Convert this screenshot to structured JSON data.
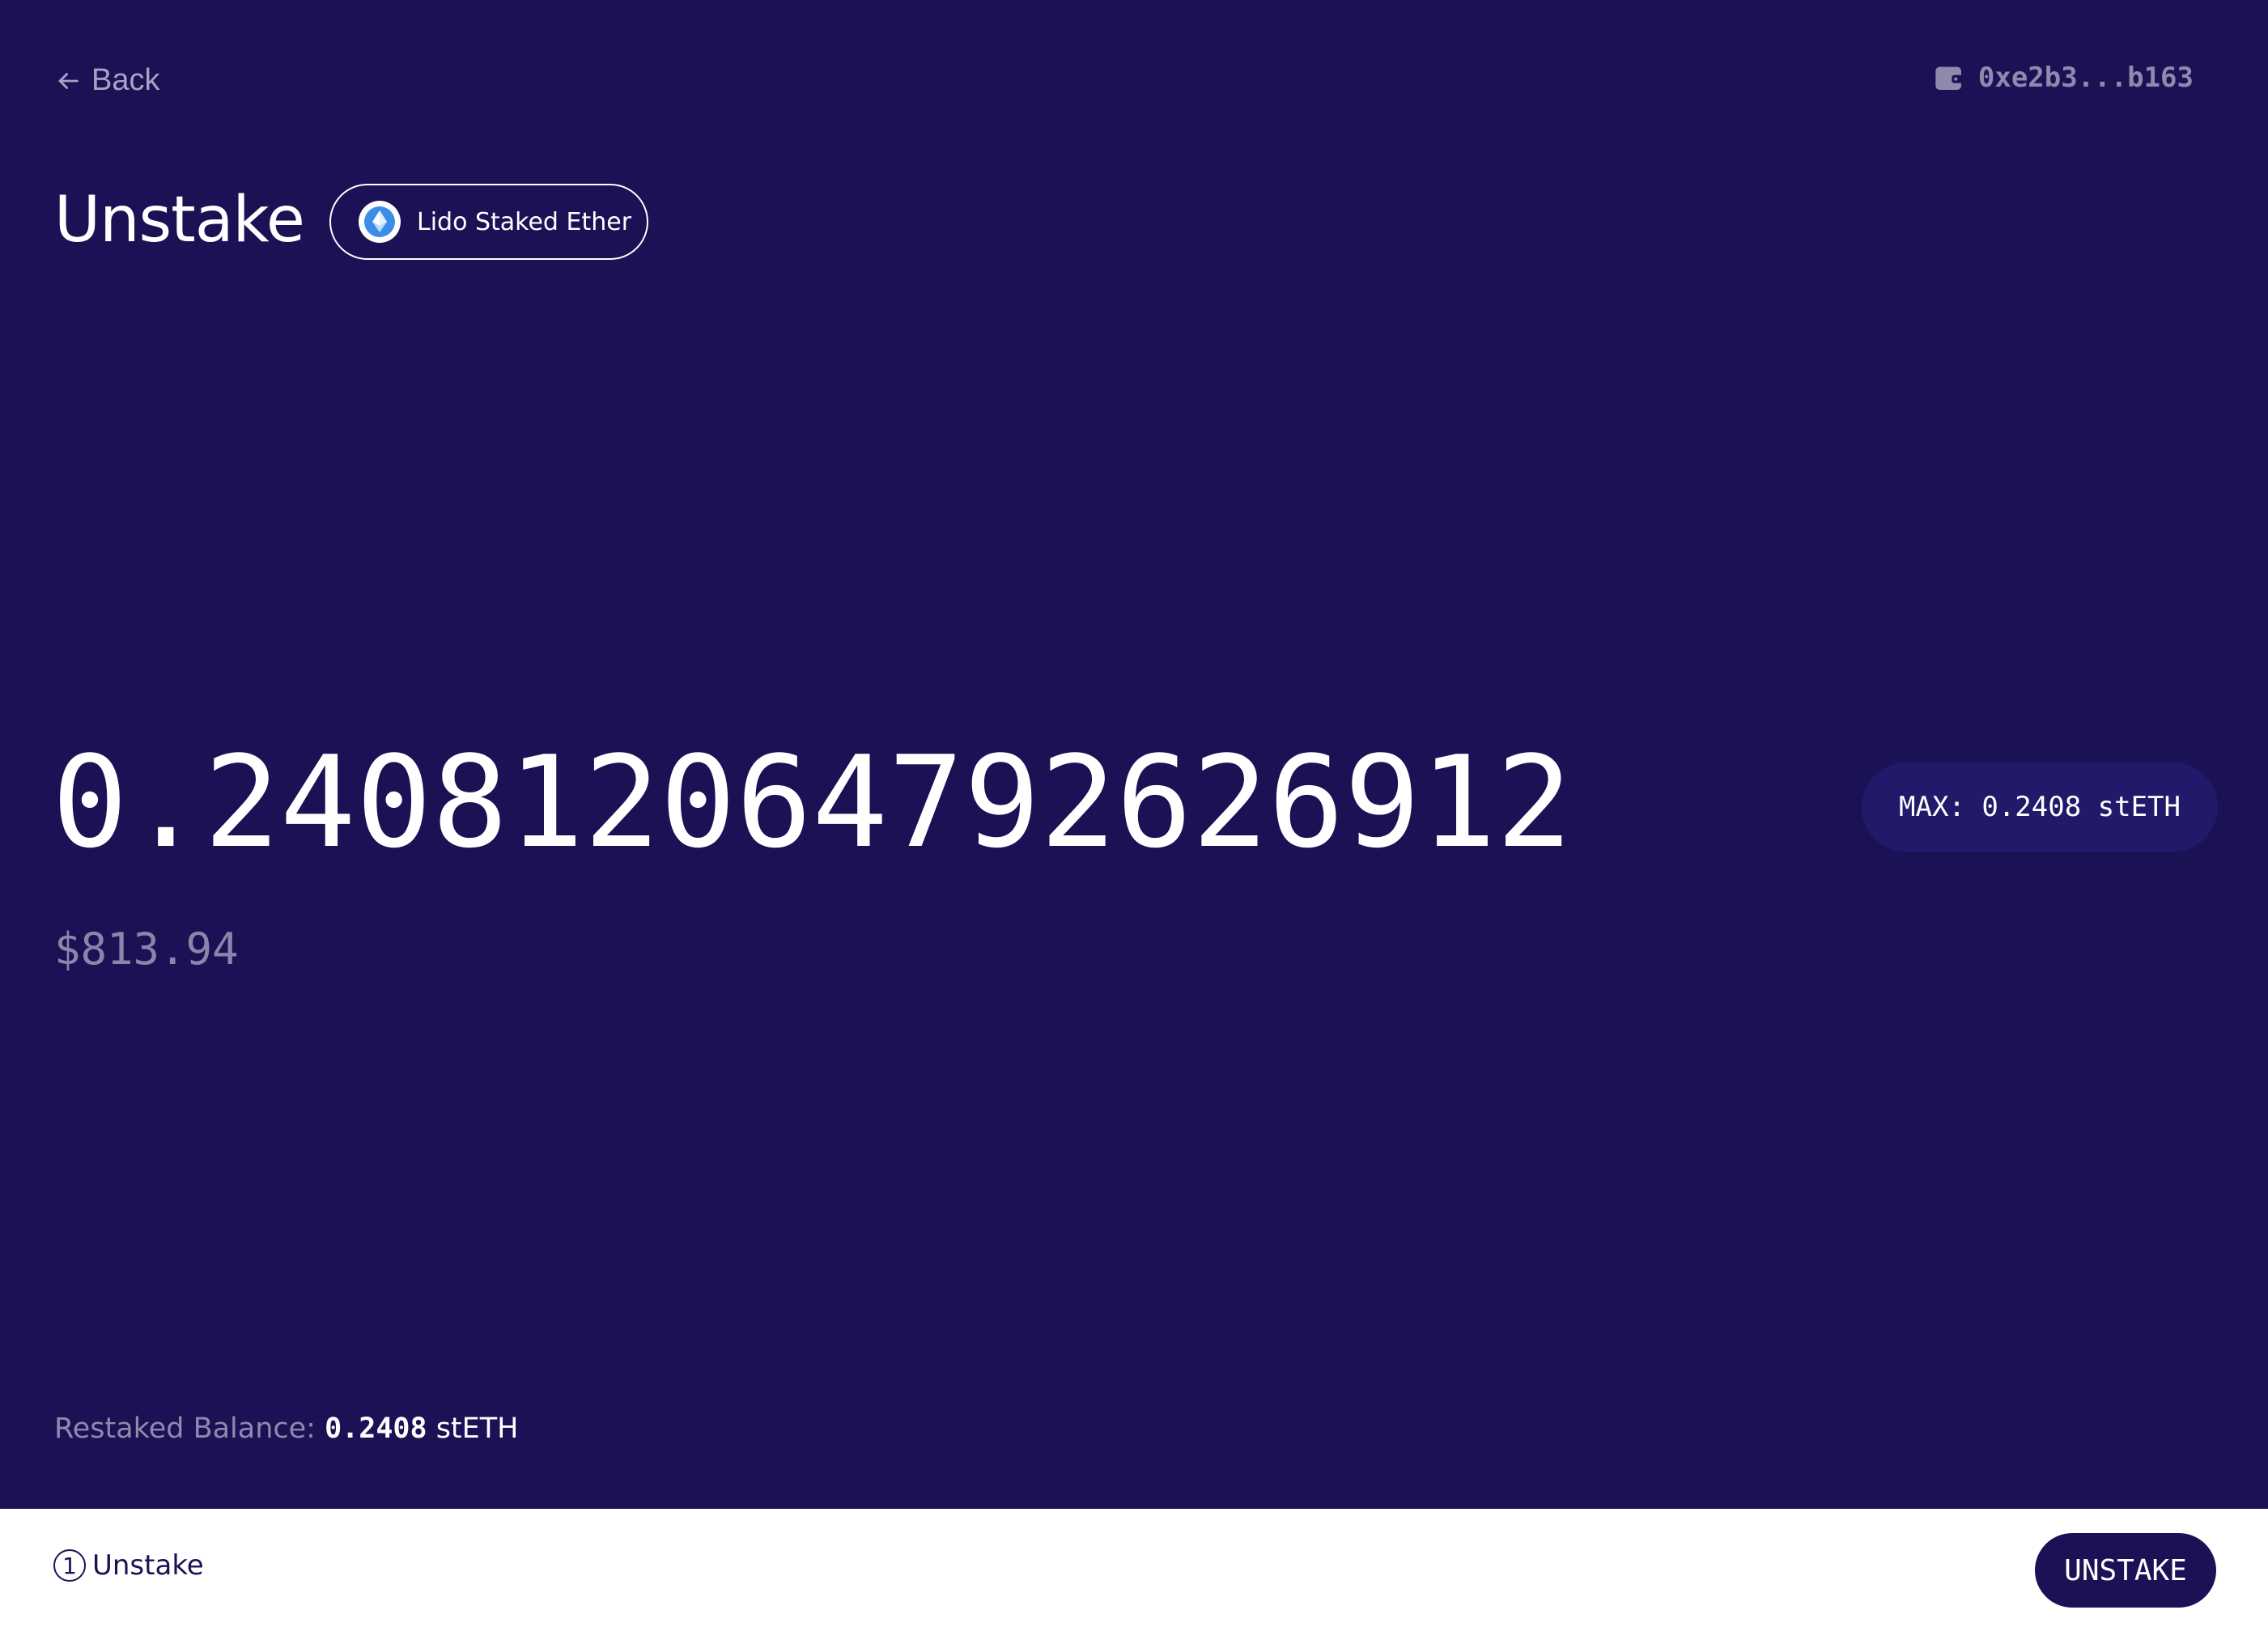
{
  "header": {
    "back_label": "Back",
    "wallet_address": "0xe2b3...b163"
  },
  "page": {
    "title": "Unstake",
    "token_name": "Lido Staked Ether"
  },
  "amount": {
    "value": "0.24081206479262691​2",
    "usd_value": "$813.94",
    "max_label": "MAX: 0.2408 stETH"
  },
  "balance": {
    "label": "Restaked Balance:",
    "value": "0.2408",
    "unit": "stETH"
  },
  "footer": {
    "step_number": "1",
    "step_label": "Unstake",
    "action_label": "UNSTAKE"
  },
  "colors": {
    "background": "#1b1155",
    "max_button_bg": "#211a6b",
    "muted_text": "#8e8aad",
    "footer_bg": "#ffffff"
  }
}
